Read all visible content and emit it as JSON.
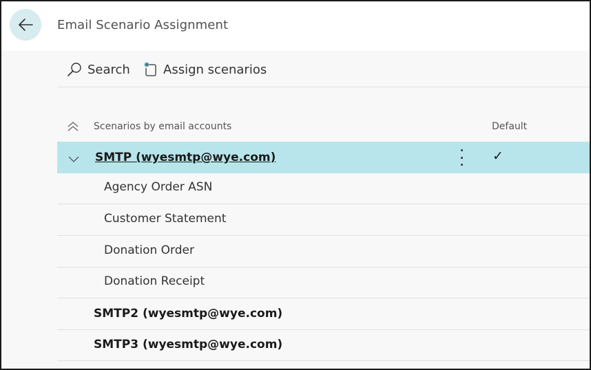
{
  "window": {
    "title": "Email Scenario Assignment"
  },
  "toolbar": {
    "search_label": "Search",
    "assign_label": "Assign scenarios"
  },
  "columns": {
    "scenarios": "Scenarios by email accounts",
    "default": "Default"
  },
  "accounts": [
    {
      "name": "SMTP (wyesmtp@wye.com)",
      "is_default": "✓",
      "expanded": true,
      "selected": true,
      "scenarios": [
        "Agency Order ASN",
        "Customer Statement",
        "Donation Order",
        "Donation Receipt"
      ]
    },
    {
      "name": "SMTP2 (wyesmtp@wye.com)",
      "expanded": false
    },
    {
      "name": "SMTP3 (wyesmtp@wye.com)",
      "expanded": false
    }
  ],
  "colors": {
    "selected_row": "#b8e5ec",
    "back_button": "#d6ecef",
    "content_bg": "#f8f8f8"
  },
  "icons": {
    "back": "arrow-left-icon",
    "search": "search-icon",
    "assign": "new-document-icon",
    "collapse_all": "double-chevron-up-icon",
    "row_expand": "chevron-down-icon",
    "row_menu": "more-vertical-icon"
  }
}
